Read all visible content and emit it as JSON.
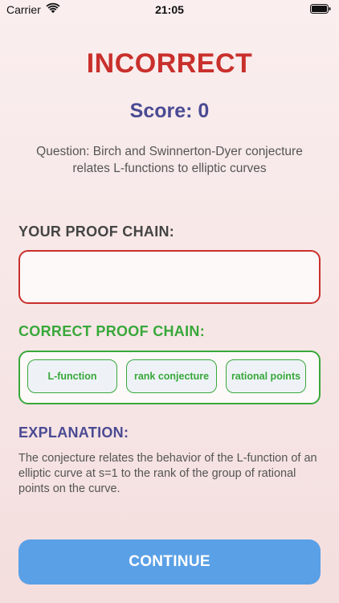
{
  "status_bar": {
    "carrier": "Carrier",
    "time": "21:05",
    "icons": [
      "wifi-icon",
      "battery-icon"
    ]
  },
  "result": {
    "title": "INCORRECT",
    "score": "Score: 0",
    "question": "Question: Birch and Swinnerton-Dyer conjecture relates L-functions to elliptic curves"
  },
  "your_chain": {
    "heading": "YOUR PROOF CHAIN:",
    "items": []
  },
  "correct_chain": {
    "heading": "CORRECT PROOF CHAIN:",
    "items": [
      "L-function",
      "rank conjecture",
      "rational points"
    ]
  },
  "explanation": {
    "heading": "EXPLANATION:",
    "text": "The conjecture relates the behavior of the L-function of an elliptic curve at s=1 to the rank of the group of rational points on the curve."
  },
  "actions": {
    "continue_label": "CONTINUE"
  },
  "colors": {
    "incorrect": "#c9302c",
    "correct": "#38a83a",
    "accent": "#4a4a93",
    "button": "#5aa0e6"
  }
}
